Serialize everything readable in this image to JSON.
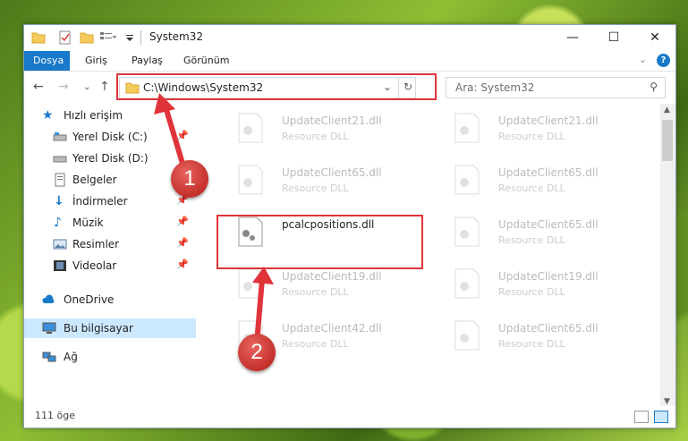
{
  "window": {
    "title": "System32"
  },
  "ribbon": {
    "tabs": [
      "Dosya",
      "Giriş",
      "Paylaş",
      "Görünüm"
    ]
  },
  "address": {
    "path": "C:\\Windows\\System32"
  },
  "search": {
    "placeholder": "Ara: System32"
  },
  "sidebar": {
    "quick_access": "Hızlı erişim",
    "items": [
      {
        "label": "Yerel Disk (C:)",
        "pinned": true
      },
      {
        "label": "Yerel Disk (D:)",
        "pinned": false
      },
      {
        "label": "Belgeler",
        "pinned": true
      },
      {
        "label": "İndirmeler",
        "pinned": true
      },
      {
        "label": "Müzik",
        "pinned": true
      },
      {
        "label": "Resimler",
        "pinned": true
      },
      {
        "label": "Videolar",
        "pinned": true
      }
    ],
    "onedrive": "OneDrive",
    "this_pc": "Bu bilgisayar",
    "network": "Ağ"
  },
  "files": [
    {
      "name": "UpdateClient21.dll",
      "type": "Resource DLL"
    },
    {
      "name": "UpdateClient21.dll",
      "type": "Resource DLL"
    },
    {
      "name": "UpdateClient65.dll",
      "type": "Resource DLL"
    },
    {
      "name": "UpdateClient65.dll",
      "type": "Resource DLL"
    },
    {
      "name": "pcalcpositions.dll",
      "type": ""
    },
    {
      "name": "UpdateClient65.dll",
      "type": "Resource DLL"
    },
    {
      "name": "UpdateClient19.dll",
      "type": "Resource DLL"
    },
    {
      "name": "UpdateClient19.dll",
      "type": "Resource DLL"
    },
    {
      "name": "UpdateClient42.dll",
      "type": "Resource DLL"
    },
    {
      "name": "UpdateClient65.dll",
      "type": "Resource DLL"
    }
  ],
  "status": {
    "count": "111 öge"
  },
  "annotations": {
    "step1": "1",
    "step2": "2",
    "color": "#e0343a"
  }
}
